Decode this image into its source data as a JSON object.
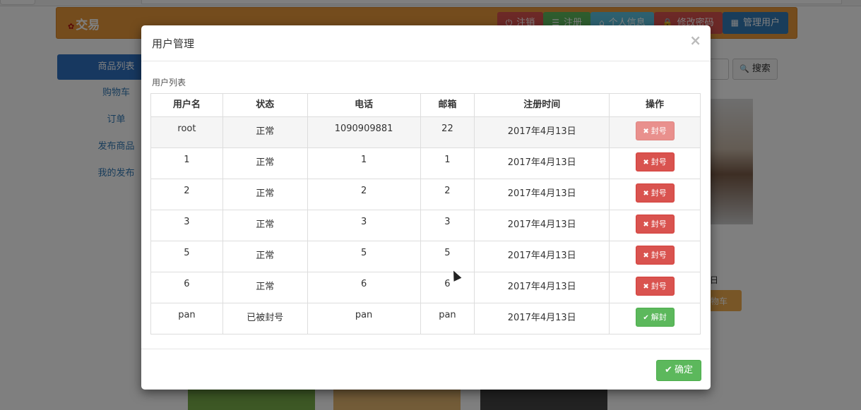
{
  "navbar": {
    "brand": "交易",
    "brand_mark": "✿",
    "buttons": [
      {
        "label": "注销",
        "icon": "power-icon",
        "glyph": "⏻",
        "color": "#d9534f"
      },
      {
        "label": "注册",
        "icon": "list-icon",
        "glyph": "☰",
        "color": "#5cb85c"
      },
      {
        "label": "个人信息",
        "icon": "home-icon",
        "glyph": "⌂",
        "color": "#5bc0de"
      },
      {
        "label": "修改密码",
        "icon": "lock-icon",
        "glyph": "🔒",
        "color": "#d9534f"
      },
      {
        "label": "管理用户",
        "icon": "grid-icon",
        "glyph": "▦",
        "color": "#337ab7"
      }
    ]
  },
  "sidebar": {
    "items": [
      {
        "label": "商品列表",
        "active": true
      },
      {
        "label": "购物车"
      },
      {
        "label": "订单"
      },
      {
        "label": "发布商品"
      },
      {
        "label": "我的发布"
      }
    ]
  },
  "search": {
    "button_label": "搜索",
    "icon": "search-icon",
    "glyph": "🔍"
  },
  "background_product": {
    "frag_text": "日",
    "cart_frag": "物车"
  },
  "modal": {
    "title": "用户管理",
    "close_glyph": "×",
    "list_label": "用户列表",
    "columns": [
      "用户名",
      "状态",
      "电话",
      "邮箱",
      "注册时间",
      "操作"
    ],
    "rows": [
      {
        "username": "root",
        "status": "正常",
        "phone": "1090909881",
        "email": "22",
        "registered": "2017年4月13日",
        "action": "封号",
        "action_type": "ban"
      },
      {
        "username": "1",
        "status": "正常",
        "phone": "1",
        "email": "1",
        "registered": "2017年4月13日",
        "action": "封号",
        "action_type": "ban"
      },
      {
        "username": "2",
        "status": "正常",
        "phone": "2",
        "email": "2",
        "registered": "2017年4月13日",
        "action": "封号",
        "action_type": "ban"
      },
      {
        "username": "3",
        "status": "正常",
        "phone": "3",
        "email": "3",
        "registered": "2017年4月13日",
        "action": "封号",
        "action_type": "ban"
      },
      {
        "username": "5",
        "status": "正常",
        "phone": "5",
        "email": "5",
        "registered": "2017年4月13日",
        "action": "封号",
        "action_type": "ban"
      },
      {
        "username": "6",
        "status": "正常",
        "phone": "6",
        "email": "6",
        "registered": "2017年4月13日",
        "action": "封号",
        "action_type": "ban"
      },
      {
        "username": "pan",
        "status": "已被封号",
        "phone": "pan",
        "email": "pan",
        "registered": "2017年4月13日",
        "action": "解封",
        "action_type": "unban"
      }
    ],
    "ban_glyph": "✖",
    "unban_glyph": "✔",
    "ok_label": "确定",
    "ok_glyph": "✔"
  }
}
